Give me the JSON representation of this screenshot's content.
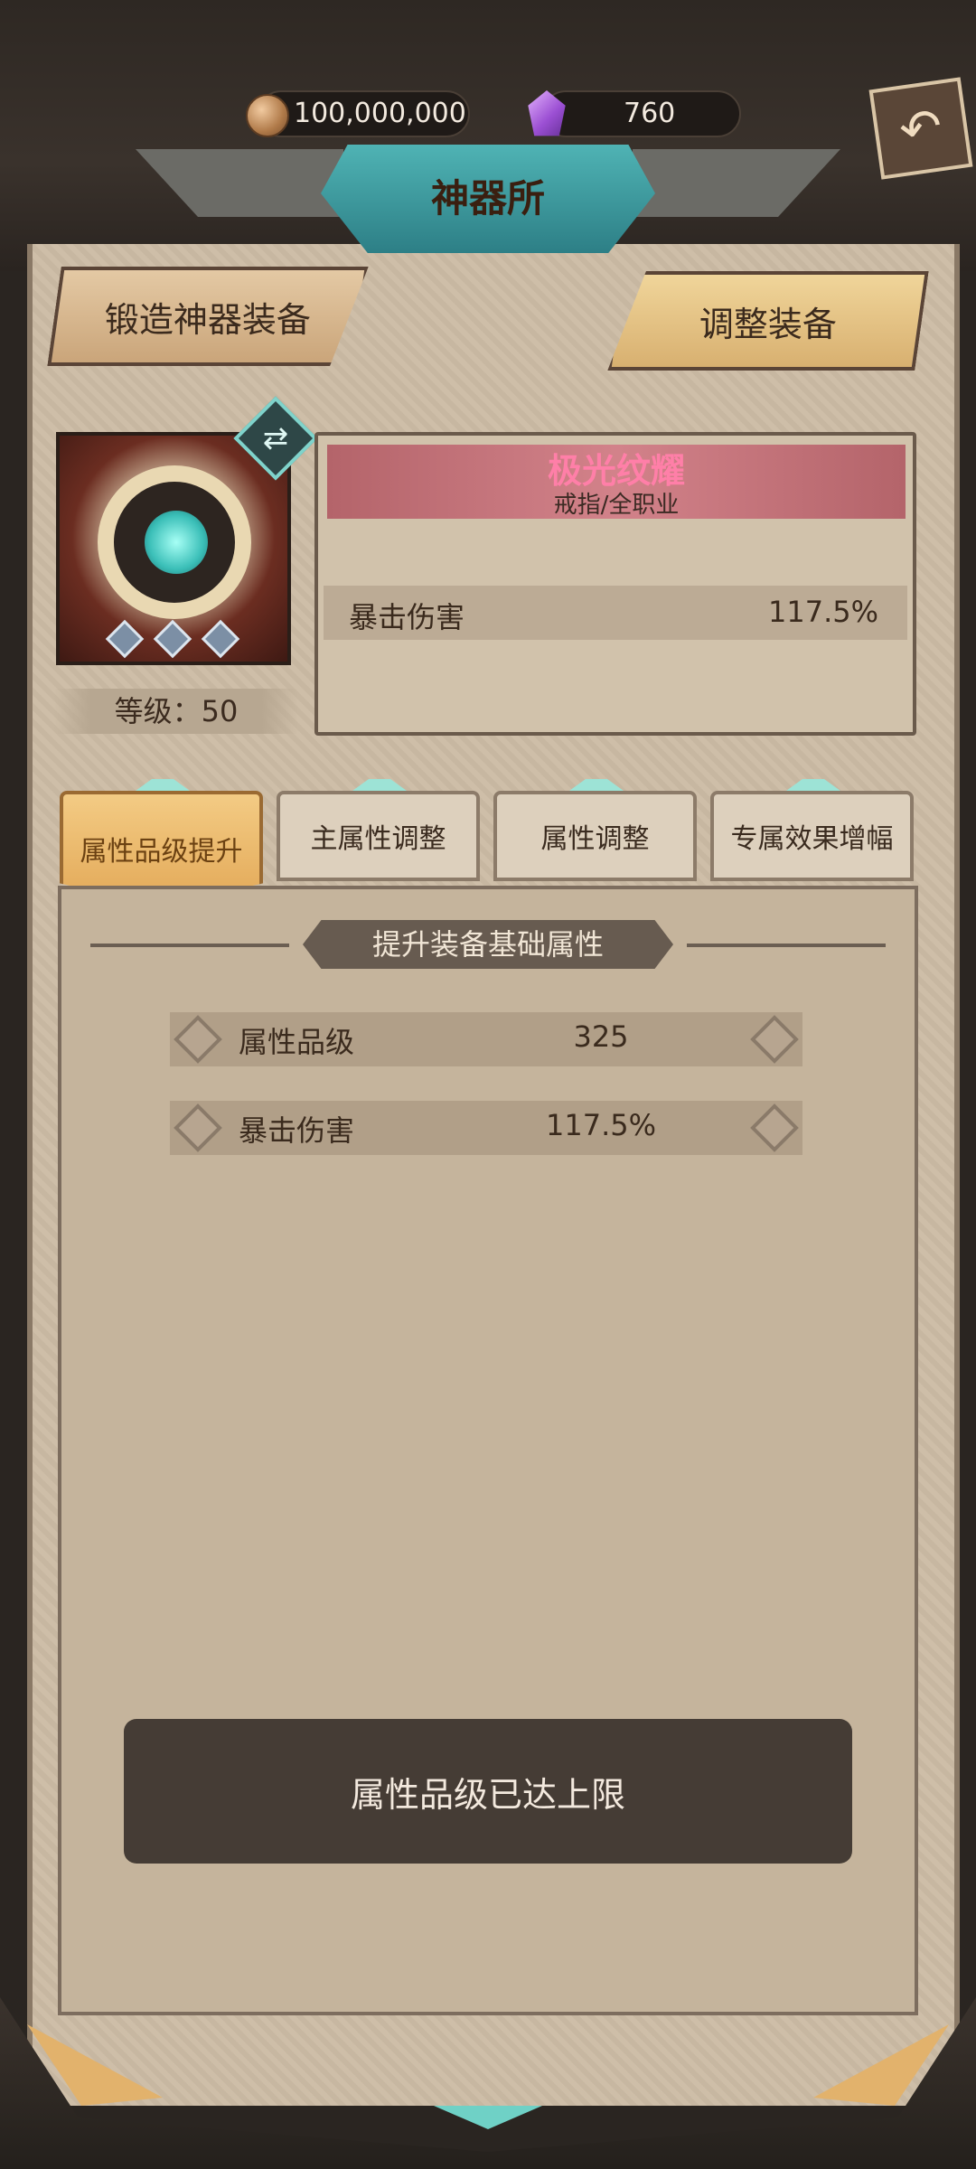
{
  "currency": {
    "gold": "100,000,000",
    "gems": "760"
  },
  "header": {
    "title": "神器所"
  },
  "top_actions": {
    "forge": "锻造神器装备",
    "adjust": "调整装备"
  },
  "item": {
    "name": "极光纹耀",
    "type": "戒指/全职业",
    "level_label": "等级：50",
    "stat": {
      "name": "暴击伤害",
      "value": "117.5%"
    },
    "socket_count": 3
  },
  "tabs": [
    {
      "label": "属性品级提升",
      "active": true
    },
    {
      "label": "主属性调整",
      "active": false
    },
    {
      "label": "属性调整",
      "active": false
    },
    {
      "label": "专属效果增幅",
      "active": false
    }
  ],
  "section": {
    "heading": "提升装备基础属性",
    "rows": [
      {
        "name": "属性品级",
        "value": "325"
      },
      {
        "name": "暴击伤害",
        "value": "117.5%"
      }
    ],
    "max_button": "属性品级已达上限"
  },
  "colors": {
    "accent_teal": "#4fb3b4",
    "item_name_pink": "#ff7fa8",
    "active_tab": "#e3a958"
  }
}
